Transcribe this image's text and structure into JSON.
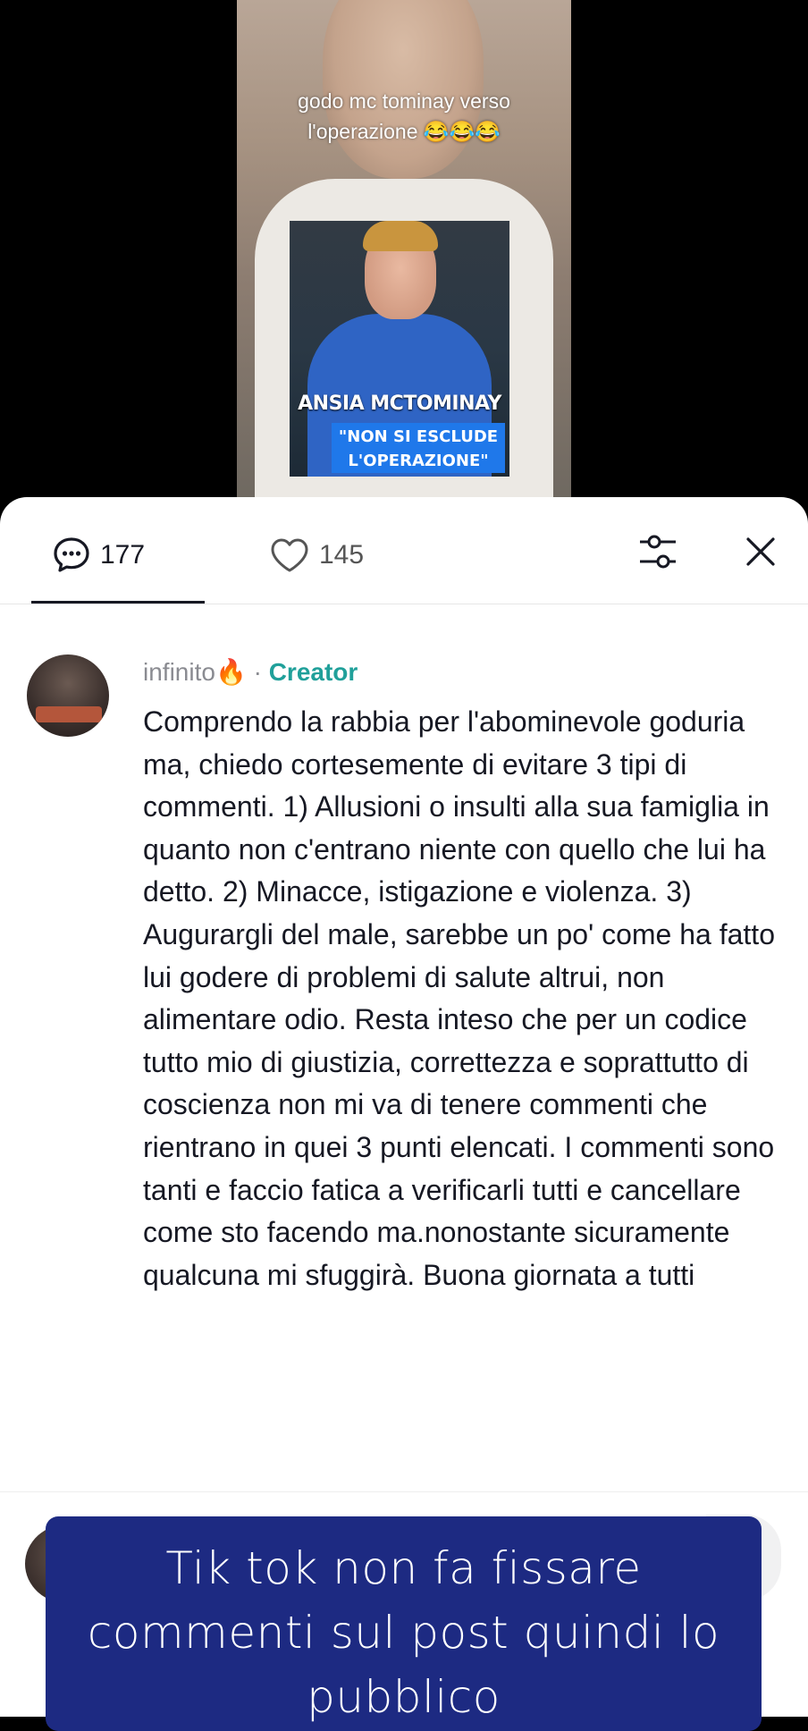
{
  "video": {
    "caption_line1": "godo mc tominay  verso",
    "caption_line2": "l'operazione 😂😂😂",
    "news_title": "ANSIA MCTOMINAY",
    "news_badge_line1": "\"NON SI ESCLUDE",
    "news_badge_line2": "L'OPERAZIONE\""
  },
  "tabs": {
    "comments_icon": "comment-bubble-icon",
    "comments_count": "177",
    "likes_icon": "heart-outline-icon",
    "likes_count": "145",
    "filter_icon": "sliders-icon",
    "close_icon": "close-icon"
  },
  "comment": {
    "username": "infinito🔥",
    "separator": " · ",
    "badge": "Creator",
    "text": "Comprendo la rabbia per l'abominevole goduria ma, chiedo cortesemente di evitare 3 tipi di commenti. 1) Allusioni o insulti alla sua famiglia in quanto non c'entrano niente con quello che lui ha detto. 2) Minacce, istigazione e violenza. 3) Augurargli del male, sarebbe un po' come ha fatto lui godere di problemi di salute altrui, non alimentare odio. Resta inteso che per un codice tutto mio di giustizia, correttezza e soprattutto di coscienza non mi va di tenere commenti che rientrano in quei 3 punti elencati. I commenti sono tanti e faccio fatica a verificarli tutti e cancellare come sto facendo ma.nonostante sicuramente qualcuna mi sfuggirà. Buona giornata a tutti"
  },
  "overlay": {
    "text_line1": "Tik tok non fa fissare",
    "text_line2": "commenti sul post quindi lo",
    "text_line3": "pubblico"
  },
  "colors": {
    "creator_badge": "#20a09a",
    "overlay_bg": "#1d2a82"
  }
}
